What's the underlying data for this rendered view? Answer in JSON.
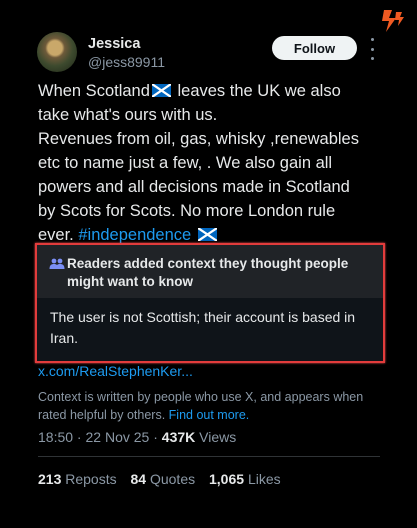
{
  "user": {
    "name": "Jessica",
    "handle": "@jess89911",
    "follow_label": "Follow"
  },
  "tweet": {
    "line1_pre": "When Scotland",
    "line1_post": " leaves the UK we also",
    "line2": "take what's ours with us.",
    "line3": "Revenues from oil, gas, whisky ,renewables",
    "line4": "etc to name just a few, . We also gain all",
    "line5": "powers and all decisions made in Scotland",
    "line6": "by Scots for Scots. No more London rule",
    "line7_pre": "ever. ",
    "hashtag": "#independence"
  },
  "community_note": {
    "title": "Readers added context they thought people might want to know",
    "body": "The user is not Scottish; their account is based in Iran.",
    "link": "x.com/RealStephenKer...",
    "footer_text": "Context is written by people who use X, and appears when rated helpful by others.",
    "footer_link": "Find out more."
  },
  "meta": {
    "time": "18:50",
    "sep1": " · ",
    "date": "22 Nov 25",
    "sep2": " · ",
    "views": "437K",
    "views_label": " Views"
  },
  "stats": {
    "reposts": "213",
    "reposts_label": "Reposts",
    "quotes": "84",
    "quotes_label": "Quotes",
    "likes": "1,065",
    "likes_label": "Likes"
  },
  "icons": {
    "flag": "scotland-flag-icon",
    "people": "people-icon",
    "more": "more-options-icon",
    "logo": "rfe-rl-logo-icon"
  },
  "colors": {
    "link": "#1d9bf0",
    "highlight_border": "#e23c3c",
    "logo": "#f05a22"
  }
}
